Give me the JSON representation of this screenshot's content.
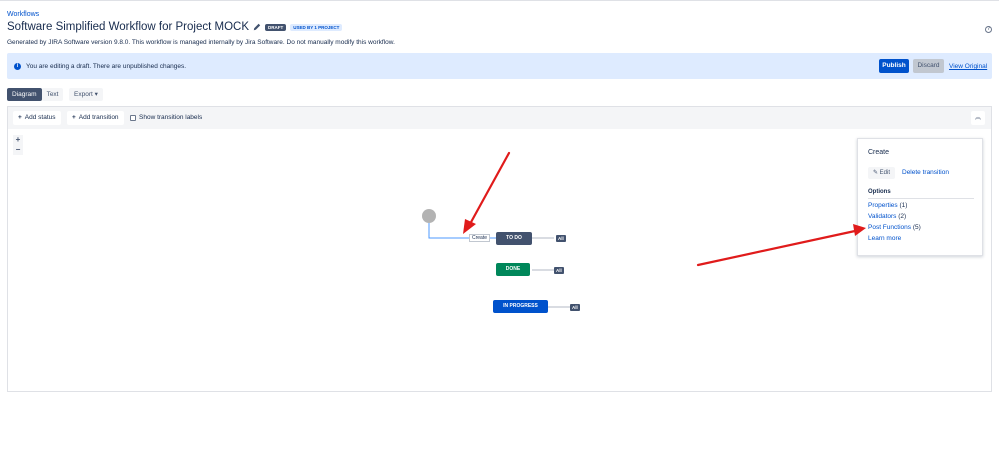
{
  "breadcrumb": "Workflows",
  "title": "Software Simplified Workflow for Project MOCK",
  "badges": {
    "draft": "DRAFT",
    "used": "USED BY 1 PROJECT"
  },
  "description": "Generated by JIRA Software version 9.8.0. This workflow is managed internally by Jira Software. Do not manually modify this workflow.",
  "banner": {
    "message": "You are editing a draft. There are unpublished changes.",
    "publish": "Publish",
    "discard": "Discard",
    "view_original": "View Original"
  },
  "view_tabs": [
    "Diagram",
    "Text"
  ],
  "export_label": "Export",
  "toolbar": {
    "add_status": "Add status",
    "add_transition": "Add transition",
    "show_labels": "Show transition labels"
  },
  "zoom": {
    "in": "+",
    "out": "−"
  },
  "diagram": {
    "transition_label": "Create",
    "all_label": "All",
    "statuses": [
      {
        "name": "TO DO",
        "color": "#42526e"
      },
      {
        "name": "DONE",
        "color": "#00875a"
      },
      {
        "name": "IN PROGRESS",
        "color": "#0052cc"
      }
    ]
  },
  "panel": {
    "title": "Create",
    "edit": "Edit",
    "delete": "Delete transition",
    "options_heading": "Options",
    "links": [
      {
        "label": "Properties",
        "count": "(1)"
      },
      {
        "label": "Validators",
        "count": "(2)"
      },
      {
        "label": "Post Functions",
        "count": "(5)"
      },
      {
        "label": "Learn more",
        "count": ""
      }
    ]
  },
  "colors": {
    "accent": "#0052cc",
    "annotation_arrow": "#e01b1b",
    "banner_bg": "#deebff"
  }
}
